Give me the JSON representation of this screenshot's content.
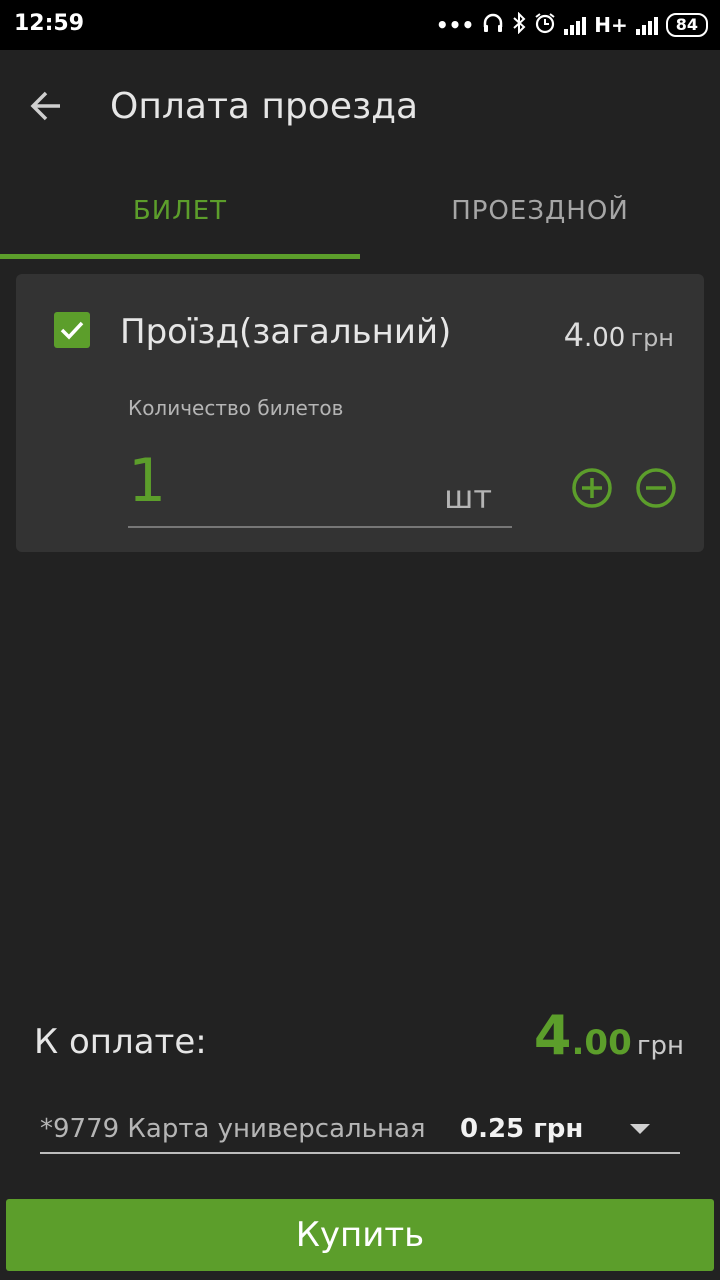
{
  "colors": {
    "accent": "#5c9e2b",
    "background": "#222222",
    "card": "#333333",
    "status_bar": "#000000"
  },
  "status_bar": {
    "time": "12:59",
    "network": "H+",
    "battery": "84",
    "icons": [
      "more-dots-icon",
      "headphones-icon",
      "bluetooth-icon",
      "alarm-icon",
      "signal-icon",
      "signal-icon",
      "battery-icon"
    ]
  },
  "app_bar": {
    "title": "Оплата проезда",
    "back_icon": "arrow-back-icon"
  },
  "tabs": [
    {
      "label": "БИЛЕТ",
      "selected": true
    },
    {
      "label": "ПРОЕЗДНОЙ",
      "selected": false
    }
  ],
  "ticket": {
    "checked": true,
    "name": "Проїзд(загальний)",
    "price_int": "4",
    "price_dec": ".00",
    "currency": "грн",
    "quantity_label": "Количество билетов",
    "quantity": "1",
    "unit": "шт"
  },
  "payment": {
    "label": "К оплате:",
    "total_int": "4",
    "total_dec": ".00",
    "currency": "грн"
  },
  "card_select": {
    "card": "*9779 Карта универсальная",
    "balance": "0.25 грн"
  },
  "buy_button": "Купить"
}
